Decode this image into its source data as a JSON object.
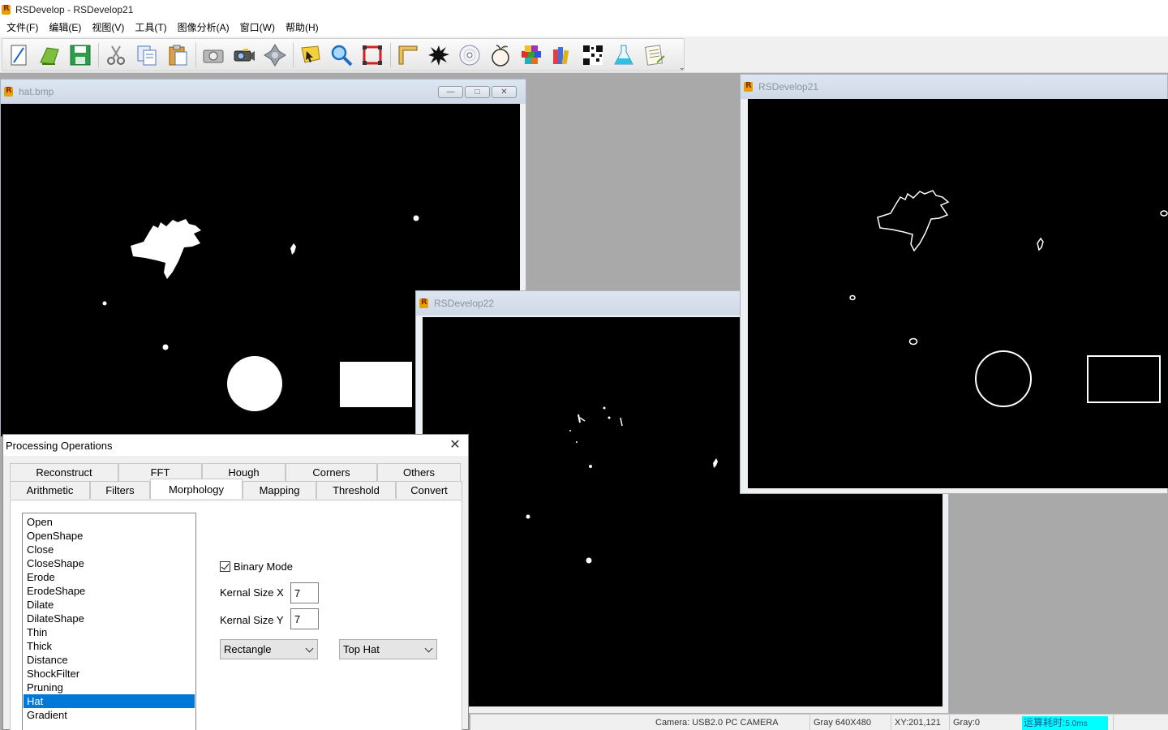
{
  "app": {
    "title": "RSDevelop - RSDevelop21"
  },
  "menu": [
    "文件(F)",
    "编辑(E)",
    "视图(V)",
    "工具(T)",
    "图像分析(A)",
    "窗口(W)",
    "帮助(H)"
  ],
  "toolbar": {
    "icons": [
      "new-file-icon",
      "open-file-icon",
      "save-icon",
      "cut-icon",
      "copy-icon",
      "paste-icon",
      "camera-icon",
      "video-camera-icon",
      "settings-cross-icon",
      "select-pointer-icon",
      "zoom-icon",
      "crop-icon",
      "ruler-icon",
      "splash-icon",
      "disc-icon",
      "apple-icon",
      "cube-icon",
      "books-icon",
      "qr-code-icon",
      "flask-icon",
      "document-icon"
    ],
    "overflow": "⌄"
  },
  "windows": {
    "hat": {
      "title": "hat.bmp",
      "min": "—",
      "max": "□",
      "close": "✕"
    },
    "dev22": {
      "title": "RSDevelop22"
    },
    "dev21": {
      "title": "RSDevelop21"
    }
  },
  "dialog": {
    "title": "Processing Operations",
    "close": "✕",
    "tabs_top": [
      "Reconstruct",
      "FFT",
      "Hough",
      "Corners",
      "Others"
    ],
    "tabs_bottom": [
      "Arithmetic",
      "Filters",
      "Morphology",
      "Mapping",
      "Threshold",
      "Convert"
    ],
    "active_tab": "Morphology",
    "operations": [
      "Open",
      "OpenShape",
      "Close",
      "CloseShape",
      "Erode",
      "ErodeShape",
      "Dilate",
      "DilateShape",
      "Thin",
      "Thick",
      "Distance",
      "ShockFilter",
      "Pruning",
      "Hat",
      "Gradient"
    ],
    "selected_operation": "Hat",
    "binary_mode_label": "Binary Mode",
    "binary_mode_checked": true,
    "kernel_x_label": "Kernal Size X",
    "kernel_x_value": "7",
    "kernel_y_label": "Kernal Size Y",
    "kernel_y_value": "7",
    "shape_select": "Rectangle",
    "hat_type_select": "Top Hat"
  },
  "status": {
    "camera": "Camera: USB2.0 PC CAMERA",
    "format": "Gray 640X480",
    "xy": "XY:201,121",
    "gray": "Gray:0",
    "timing_label": "运算耗时:",
    "timing_value": "5.0ms"
  }
}
